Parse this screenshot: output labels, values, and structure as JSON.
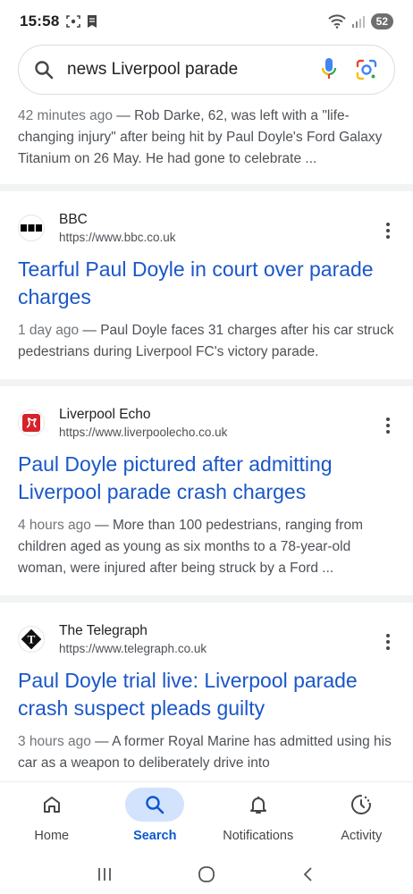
{
  "status_bar": {
    "time": "15:58",
    "battery": "52"
  },
  "search": {
    "query": "news Liverpool parade"
  },
  "top_result": {
    "date": "42 minutes ago",
    "snippet": " — Rob Darke, 62, was left with a \"life-changing injury\" after being hit by Paul Doyle's Ford Galaxy Titanium on 26 May. He had gone to celebrate ..."
  },
  "results": [
    {
      "source": "BBC",
      "url": "https://www.bbc.co.uk",
      "title": "Tearful Paul Doyle in court over parade charges",
      "date": "1 day ago",
      "snippet": " — Paul Doyle faces 31 charges after his car struck pedestrians during Liverpool FC's victory parade."
    },
    {
      "source": "Liverpool Echo",
      "url": "https://www.liverpoolecho.co.uk",
      "title": "Paul Doyle pictured after admitting Liverpool parade crash charges",
      "date": "4 hours ago",
      "snippet": " — More than 100 pedestrians, ranging from children aged as young as six months to a 78-year-old woman, were injured after being struck by a Ford ..."
    },
    {
      "source": "The Telegraph",
      "url": "https://www.telegraph.co.uk",
      "title": "Paul Doyle trial live: Liverpool parade crash suspect pleads guilty",
      "date": "3 hours ago",
      "snippet": " — A former Royal Marine has admitted using his car as a weapon to deliberately drive into"
    }
  ],
  "bottom_nav": {
    "home": "Home",
    "search": "Search",
    "notifications": "Notifications",
    "activity": "Activity"
  },
  "colors": {
    "link": "#1a57c8",
    "active_nav": "#0b57d0",
    "active_pill": "#d3e3fd"
  },
  "icons": {
    "search": "search-icon",
    "mic": "mic-icon",
    "lens": "lens-icon",
    "more": "more-vert-icon"
  }
}
